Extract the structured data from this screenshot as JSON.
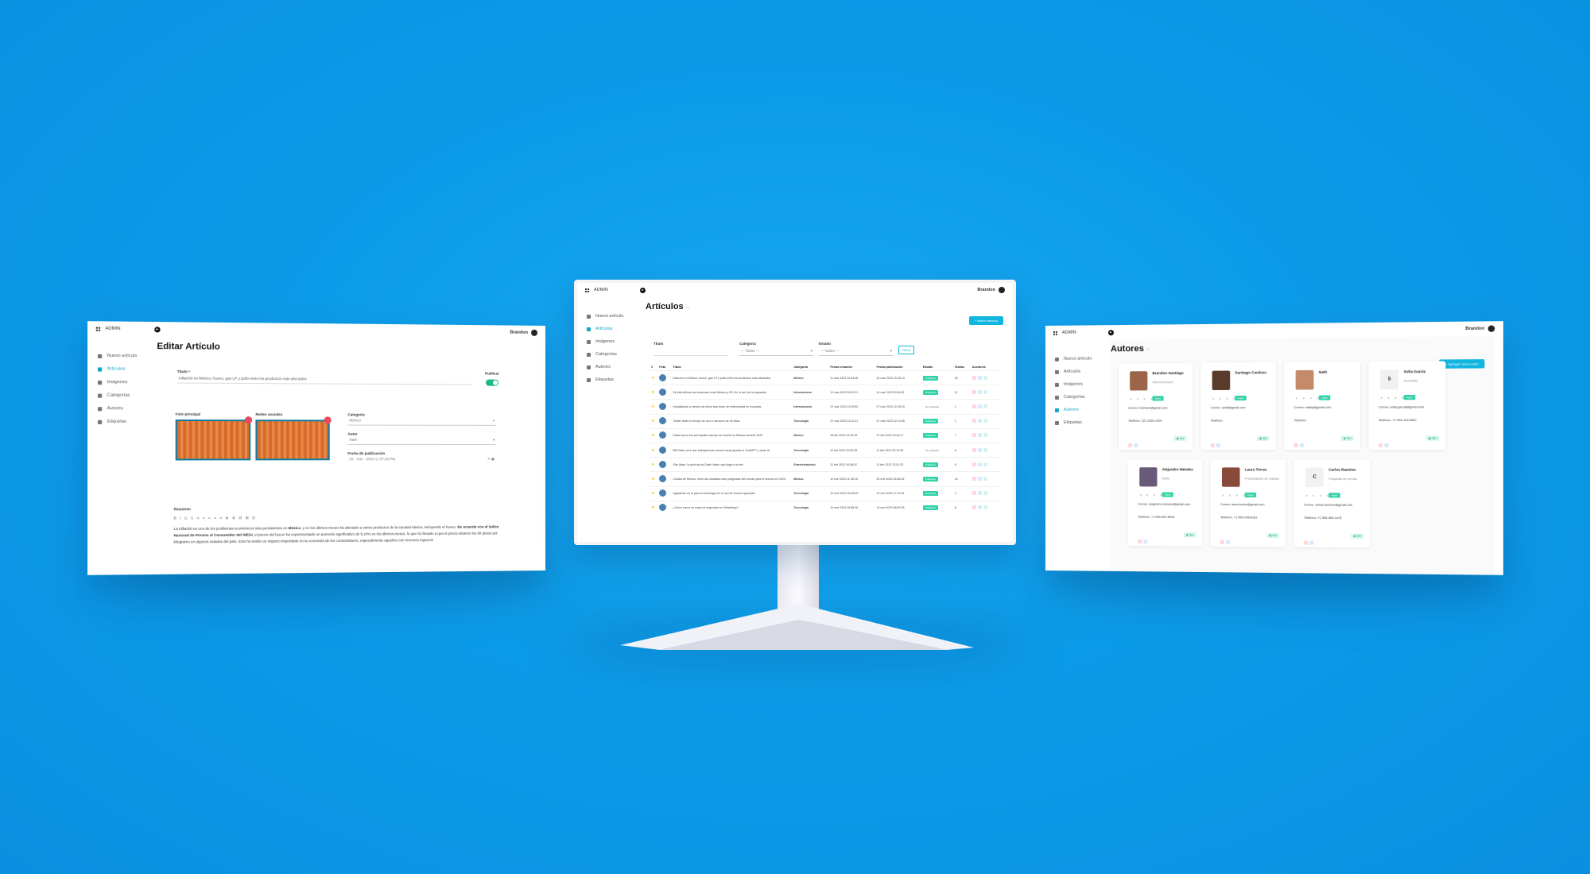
{
  "brand": {
    "background": "#0c9be8",
    "accent": "#11b6e0",
    "published": "#2ed3a8"
  },
  "common": {
    "admin_label": "ADMIN",
    "user_name": "Brandon",
    "sidebar": [
      "Nuevo artículo",
      "Artículos",
      "Imágenes",
      "Categorías",
      "Autores",
      "Etiquetas"
    ]
  },
  "left": {
    "title": "Editar Artículo",
    "titulo_label": "Título *",
    "titulo_value": "Inflación en México: huevo, gas LP y pollo entre los productos más afectados",
    "publicar_label": "Publicar",
    "foto_label": "Foto principal",
    "redes_label": "Redes sociales",
    "categoria_label": "Categoría",
    "categoria_value": "México",
    "autor_label": "Autor",
    "autor_value": "Nath",
    "fecha_label": "Fecha de publicación",
    "fecha_value": "22 - mar - 2023 ◷ 07:25  PM",
    "resumen_label": "Resumen",
    "toolbar": "B I U S A ≡ ≡ ≡ ≡ ⊕ ⊗ ⊟ ⊞ ⊡",
    "resumen_p1": "La inflación es uno de los problemas económicos más persistentes en ",
    "resumen_b1": "México",
    "resumen_p2": ", y en los últimos meses ha afectado a varios productos de la canasta básica, incluyendo el huevo. ",
    "resumen_b2": "De acuerdo con el Índice Nacional de Precios al Consumidor del INEGI",
    "resumen_p3": ", el precio del huevo ha experimentado un aumento significativo de 9.24% en los últimos meses, lo que ha llevado a que el precio alcance los 60 pesos por kilogramo en algunos estados del país. Esto ha tenido un impacto importante en la economía de los consumidores, especialmente aquellos con menores ingresos"
  },
  "center": {
    "title": "Artículos",
    "new_button": "+ Nuevo artículo",
    "filter_titulo": "Título",
    "filter_categoria": "Categoría",
    "filter_categoria_value": "--- Todos ---",
    "filter_estado": "Estado",
    "filter_estado_value": "--- Todos ---",
    "filter_button": "Filtrar",
    "columns": [
      "#",
      "Foto",
      "Título",
      "Categoría",
      "Fecha creación",
      "Fecha publicación",
      "Estado",
      "Visitas",
      "Acciones"
    ],
    "rows": [
      {
        "title": "Inflación en México: huevo, gas LP y pollo entre los productos más afectados",
        "cat": "México",
        "created": "11 mar 2023 10:44:48",
        "pub": "22 mar 2023 19:25:14",
        "status": "Publicado",
        "visits": "30"
      },
      {
        "title": "Se intensifican las tensiones entre México y EE.UU. a raíz de la migración",
        "cat": "Internacional",
        "created": "12 mar 2023 09:20:11",
        "pub": "14 mar 2023 03:54:01",
        "status": "Publicado",
        "visits": "12"
      },
      {
        "title": "Hospitalizan a cientos de niños tras brote de enfermedad en escuelas",
        "cat": "Internacional",
        "created": "07 mar 2023 12:09:51",
        "pub": "07 mar 2023 12:15:19",
        "status": "No publicado",
        "visits": "1"
      },
      {
        "title": "Twitter limita el tiempo de uso a menores de 18 años",
        "cat": "Tecnología",
        "created": "07 mar 2023 12:22:11",
        "pub": "07 mar 2023 12:13:08",
        "status": "Publicado",
        "visits": "1"
      },
      {
        "title": "Estas fueron las principales causas de muerte en México durante 2022",
        "cat": "México",
        "created": "28 feb 2023 23:29:49",
        "pub": "27 feb 2023 23:40:17",
        "status": "Publicado",
        "visits": "7"
      },
      {
        "title": "Bill Gates cree que trabajaremos menos horas gracias a ChatGPT y otras IA",
        "cat": "Tecnología",
        "created": "11 feb 2023 04:52:28",
        "pub": "11 feb 2023 20:12:09",
        "status": "No publicado",
        "visits": "8"
      },
      {
        "title": "Star Wars: la película de Darth Vader que llega a la tele",
        "cat": "Entretenimiento",
        "created": "11 feb 2023 04:08:32",
        "pub": "11 feb 2023 22:01:23",
        "status": "Publicado",
        "visits": "9"
      },
      {
        "title": "Ciudad de México, entre las ciudades más peligrosas del mundo para el turismo en 2023",
        "cat": "México",
        "created": "11 ene 2023 11:35:15",
        "pub": "20 ene 2023 18:54:32",
        "status": "Publicado",
        "visits": "14"
      },
      {
        "title": "Agraderán en el país la tecnología en el uso de drones agrícolas",
        "cat": "Tecnología",
        "created": "10 ene 2023 10:45:09",
        "pub": "10 ene 2023 17:19:04",
        "status": "Publicado",
        "visits": "3"
      },
      {
        "title": "¿Cómo hacer mi copia de seguridad en WhatsApp?",
        "cat": "Tecnología",
        "created": "10 ene 2023 16:56:18",
        "pub": "10 ene 2023 08:50:25",
        "status": "Publicado",
        "visits": "6"
      }
    ]
  },
  "right": {
    "title": "Autores",
    "add_button": "+ Agregar nuevo autor",
    "status_label": "Activo",
    "mail_label": "Correo:",
    "tel_label": "Teléfono:",
    "view_label": "◉ Ver",
    "authors": [
      {
        "name": "Brandon Santiago",
        "role": "Web Developer",
        "mail": "brandon@gmail.com",
        "tel": "221 2356 1204",
        "init": ""
      },
      {
        "name": "Santiago Cardoso",
        "role": "",
        "mail": "santi@gmail.com",
        "tel": "",
        "init": ""
      },
      {
        "name": "Nath",
        "role": "",
        "mail": "nataly@gmail.com",
        "tel": "",
        "init": ""
      },
      {
        "name": "Sofia García",
        "role": "Periodista",
        "mail": "sofia.garcia@gmail.com",
        "tel": "+1 555-123-4567",
        "init": "S"
      },
      {
        "name": "Alejandro Méndez",
        "role": "Editor",
        "mail": "alejandro.mendez@gmail.com",
        "tel": "+1 555-987-6543",
        "init": ""
      },
      {
        "name": "Laura Torres",
        "role": "Presentadora de noticias",
        "mail": "laura.torres@gmail.com",
        "tel": "+1 555-246-8102",
        "init": ""
      },
      {
        "name": "Carlos Ramírez",
        "role": "Fotógrafo de prensa",
        "mail": "carlos.ramirez@gmail.com",
        "tel": "+1 555-369-1478",
        "init": "C"
      }
    ]
  }
}
